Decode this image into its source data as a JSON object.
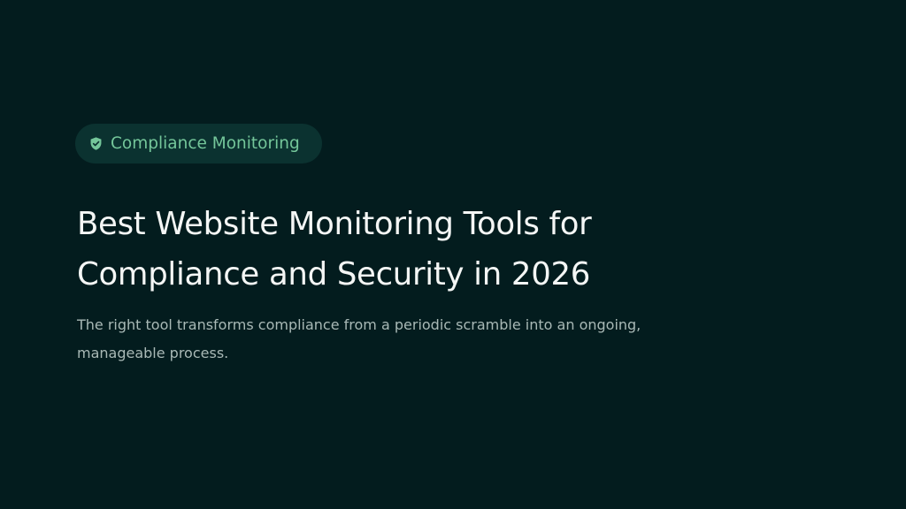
{
  "badge": {
    "icon": "shield-check-icon",
    "label": "Compliance Monitoring"
  },
  "title": {
    "line1": "Best Website Monitoring Tools for",
    "line2": "Compliance and Security in 2026"
  },
  "subtitle": {
    "line1": "The right tool transforms compliance from a periodic scramble into an ongoing,",
    "line2": "manageable process."
  },
  "colors": {
    "background": "#031c1e",
    "badge_background": "#0b3230",
    "accent": "#74c69a",
    "title": "#f4f6f5",
    "subtitle": "#a9b9b6"
  }
}
